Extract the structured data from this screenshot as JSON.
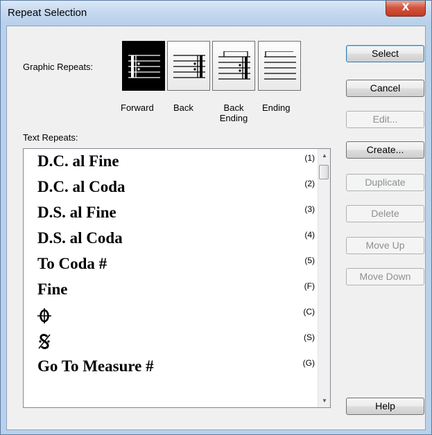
{
  "window": {
    "title": "Repeat Selection",
    "close_glyph": "X"
  },
  "graphic_repeats": {
    "label": "Graphic Repeats:",
    "buttons": [
      {
        "caption": "Forward",
        "selected": true,
        "icon": "forward-repeat-icon"
      },
      {
        "caption": "Back",
        "selected": false,
        "icon": "back-repeat-icon"
      },
      {
        "caption": "Back Ending",
        "selected": false,
        "icon": "back-ending-repeat-icon"
      },
      {
        "caption": "Ending",
        "selected": false,
        "icon": "ending-repeat-icon"
      }
    ]
  },
  "text_repeats": {
    "label": "Text Repeats:",
    "items": [
      {
        "label": "D.C. al Fine",
        "code": "(1)"
      },
      {
        "label": "D.C. al Coda",
        "code": "(2)"
      },
      {
        "label": "D.S. al Fine",
        "code": "(3)"
      },
      {
        "label": "D.S. al Coda",
        "code": "(4)"
      },
      {
        "label": "To Coda #",
        "code": "(5)"
      },
      {
        "label": "Fine",
        "code": "(F)"
      },
      {
        "label": "",
        "code": "(C)",
        "symbol": "coda-icon"
      },
      {
        "label": "",
        "code": "(S)",
        "symbol": "segno-icon"
      },
      {
        "label": "Go To Measure #",
        "code": "(G)"
      }
    ]
  },
  "buttons": {
    "select": "Select",
    "cancel": "Cancel",
    "edit": "Edit...",
    "create": "Create...",
    "duplicate": "Duplicate",
    "delete": "Delete",
    "move_up": "Move Up",
    "move_down": "Move Down",
    "help": "Help"
  },
  "colors": {
    "selected_button": "#000000",
    "disabled_text": "#8f8f8f",
    "title_bar": "#c6d9ef"
  }
}
